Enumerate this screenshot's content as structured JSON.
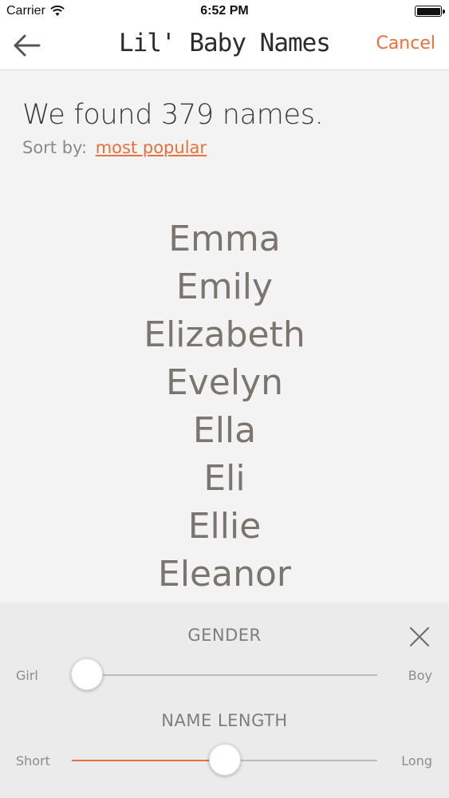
{
  "status_bar": {
    "carrier": "Carrier",
    "time": "6:52 PM"
  },
  "nav": {
    "title": "Lil' Baby Names",
    "cancel_label": "Cancel",
    "back_icon": "arrow-left-icon"
  },
  "results": {
    "summary": "We found 379 names.",
    "sort_prefix": "Sort by:",
    "sort_value": "most popular",
    "names": [
      "Emma",
      "Emily",
      "Elizabeth",
      "Evelyn",
      "Ella",
      "Eli",
      "Ellie",
      "Eleanor"
    ]
  },
  "filters": {
    "gender": {
      "label": "GENDER",
      "min_label": "Girl",
      "max_label": "Boy",
      "value": 0.05
    },
    "name_length": {
      "label": "NAME LENGTH",
      "min_label": "Short",
      "max_label": "Long",
      "value": 0.5
    },
    "close_icon": "close-icon"
  },
  "colors": {
    "accent": "#e8703a",
    "name_text": "#7a766e",
    "panel_bg": "#ebebeb",
    "page_bg": "#f3f3f3"
  }
}
